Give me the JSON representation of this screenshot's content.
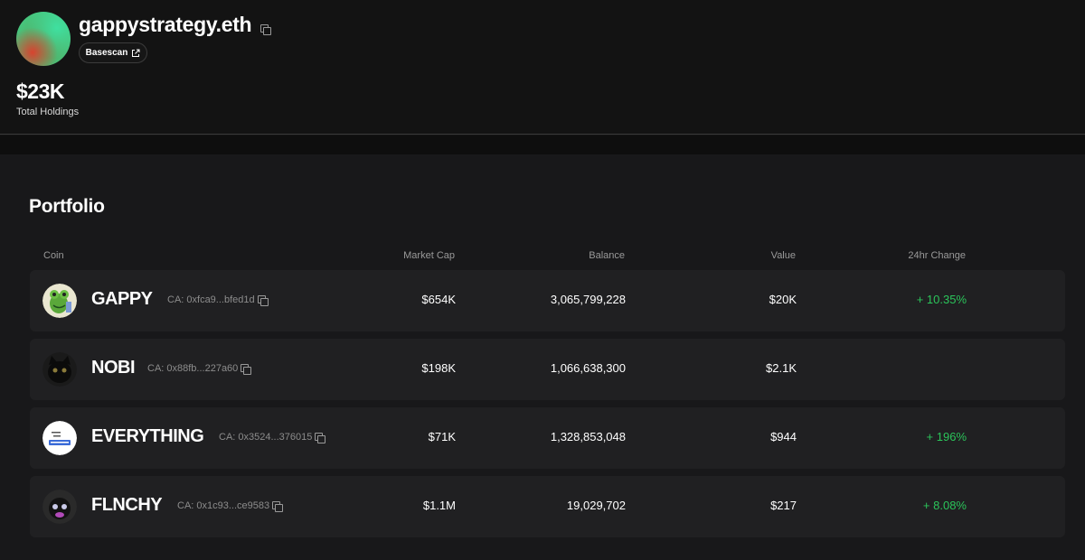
{
  "profile": {
    "name": "gappystrategy.eth",
    "basescan_label": "Basescan",
    "holdings_value": "$23K",
    "holdings_label": "Total Holdings"
  },
  "portfolio": {
    "title": "Portfolio",
    "columns": {
      "coin": "Coin",
      "market_cap": "Market Cap",
      "balance": "Balance",
      "value": "Value",
      "change": "24hr Change"
    },
    "rows": [
      {
        "ticker": "GAPPY",
        "ca": "CA: 0xfca9...bfed1d",
        "market_cap": "$654K",
        "balance": "3,065,799,228",
        "value": "$20K",
        "change": "+ 10.35%"
      },
      {
        "ticker": "NOBI",
        "ca": "CA: 0x88fb...227a60",
        "market_cap": "$198K",
        "balance": "1,066,638,300",
        "value": "$2.1K",
        "change": ""
      },
      {
        "ticker": "EVERYTHING",
        "ca": "CA: 0x3524...376015",
        "market_cap": "$71K",
        "balance": "1,328,853,048",
        "value": "$944",
        "change": "+ 196%"
      },
      {
        "ticker": "FLNCHY",
        "ca": "CA: 0x1c93...ce9583",
        "market_cap": "$1.1M",
        "balance": "19,029,702",
        "value": "$217",
        "change": "+ 8.08%"
      }
    ],
    "icons": [
      "frog-icon",
      "black-cat-icon",
      "everything-logo-icon",
      "cat-avatar-icon"
    ]
  },
  "colors": {
    "positive": "#2bc45a",
    "background": "#18181a",
    "row_background": "#202022"
  }
}
